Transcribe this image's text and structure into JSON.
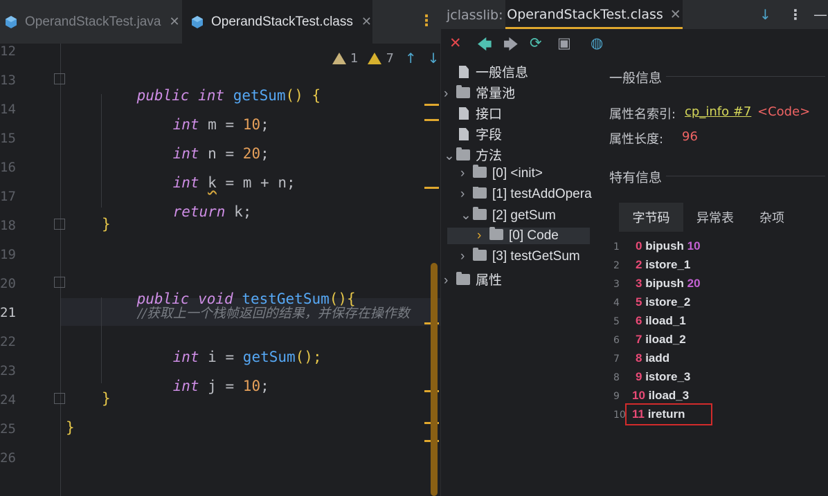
{
  "editor": {
    "tabs": [
      {
        "label": "OperandStackTest.java",
        "active": false
      },
      {
        "label": "OperandStackTest.class",
        "active": true
      }
    ],
    "warnings": {
      "weak_count": "1",
      "warn_count": "7"
    },
    "line_numbers": [
      "12",
      "13",
      "14",
      "15",
      "16",
      "17",
      "18",
      "19",
      "20",
      "21",
      "22",
      "23",
      "24",
      "25",
      "26"
    ],
    "active_line": "21",
    "code": {
      "l13_kw1": "public",
      "l13_kw2": "int",
      "l13_fn": "getSum",
      "l13_rest": "() {",
      "l14_kw": "int",
      "l14_var": "m",
      "l14_eq": "=",
      "l14_num": "10",
      "l14_end": ";",
      "l15_kw": "int",
      "l15_var": "n",
      "l15_eq": "=",
      "l15_num": "20",
      "l15_end": ";",
      "l16_kw": "int",
      "l16_var": "k",
      "l16_rest": "= m + n;",
      "l17_kw": "return",
      "l17_rest": "k;",
      "l18_brace": "}",
      "l20_kw1": "public",
      "l20_kw2": "void",
      "l20_fn": "testGetSum",
      "l20_rest": "(){",
      "l21_comment": "//获取上一个栈帧返回的结果，并保存在操作数",
      "l22_kw": "int",
      "l22_var": "i",
      "l22_eq": "=",
      "l22_fn": "getSum",
      "l22_rest": "();",
      "l23_kw": "int",
      "l23_var": "j",
      "l23_eq": "=",
      "l23_num": "10",
      "l23_end": ";",
      "l24_brace": "}",
      "l25_brace": "}"
    }
  },
  "jclasslib": {
    "label": "jclasslib:",
    "tab": "OperandStackTest.class",
    "tree": {
      "general": "一般信息",
      "constant_pool": "常量池",
      "interfaces": "接口",
      "fields": "字段",
      "methods": "方法",
      "m0": "[0] <init>",
      "m1": "[1] testAddOpera",
      "m2": "[2] getSum",
      "m2_code": "[0] Code",
      "m3": "[3] testGetSum",
      "attributes": "属性"
    },
    "general_title": "一般信息",
    "attr_name_label": "属性名索引:",
    "attr_name_link": "cp_info #7",
    "attr_name_value": "<Code>",
    "attr_len_label": "属性长度:",
    "attr_len_value": "96",
    "specific_title": "特有信息",
    "subtabs": [
      "字节码",
      "异常表",
      "杂项"
    ],
    "bytecode": [
      {
        "line": "1",
        "offset": "0",
        "op": "bipush",
        "arg": "10"
      },
      {
        "line": "2",
        "offset": "2",
        "op": "istore_1",
        "arg": ""
      },
      {
        "line": "3",
        "offset": "3",
        "op": "bipush",
        "arg": "20"
      },
      {
        "line": "4",
        "offset": "5",
        "op": "istore_2",
        "arg": ""
      },
      {
        "line": "5",
        "offset": "6",
        "op": "iload_1",
        "arg": ""
      },
      {
        "line": "6",
        "offset": "7",
        "op": "iload_2",
        "arg": ""
      },
      {
        "line": "7",
        "offset": "8",
        "op": "iadd",
        "arg": ""
      },
      {
        "line": "8",
        "offset": "9",
        "op": "istore_3",
        "arg": ""
      },
      {
        "line": "9",
        "offset": "10",
        "op": "iload_3",
        "arg": ""
      },
      {
        "line": "10",
        "offset": "11",
        "op": "ireturn",
        "arg": ""
      }
    ]
  },
  "colors": {
    "accent": "#e0a82e",
    "offset": "#e84a76",
    "highlight_box": "#d22b2b"
  }
}
